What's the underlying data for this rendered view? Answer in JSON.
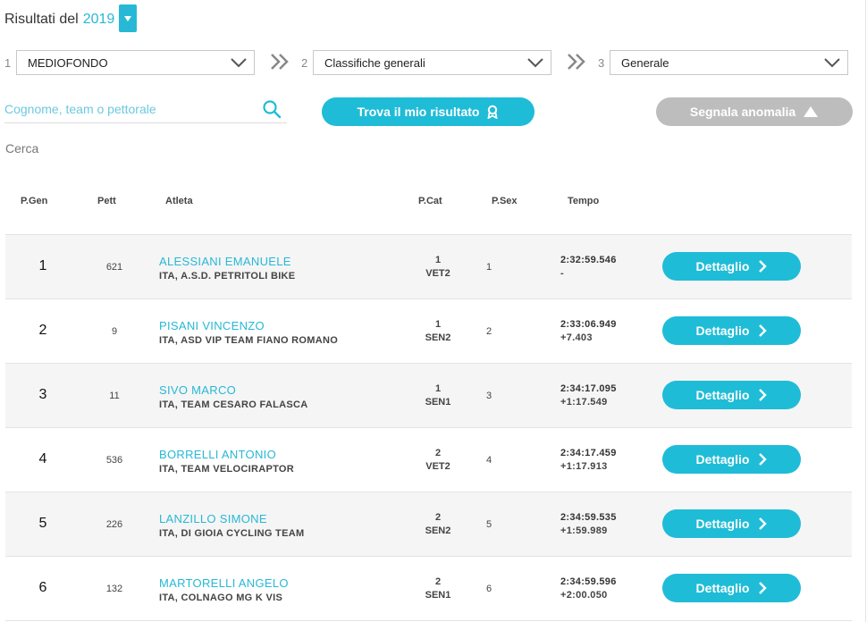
{
  "header": {
    "prefix": "Risultati del",
    "year": "2019"
  },
  "filters": [
    {
      "num": "1",
      "value": "MEDIOFONDO"
    },
    {
      "num": "2",
      "value": "Classifiche generali"
    },
    {
      "num": "3",
      "value": "Generale"
    }
  ],
  "search": {
    "placeholder": "Cognome, team o pettorale",
    "cerca_label": "Cerca"
  },
  "buttons": {
    "find": "Trova il mio risultato",
    "report": "Segnala anomalia",
    "detail": "Dettaglio"
  },
  "columns": {
    "pgen": "P.Gen",
    "pett": "Pett",
    "atleta": "Atleta",
    "pcat": "P.Cat",
    "psex": "P.Sex",
    "tempo": "Tempo"
  },
  "rows": [
    {
      "pos": "1",
      "pett": "621",
      "name": "ALESSIANI EMANUELE",
      "team": "ITA, A.S.D. PETRITOLI BIKE",
      "cat_pos": "1",
      "cat": "VET2",
      "sex": "1",
      "time": "2:32:59.546",
      "gap": "-"
    },
    {
      "pos": "2",
      "pett": "9",
      "name": "PISANI VINCENZO",
      "team": "ITA, ASD VIP TEAM FIANO ROMANO",
      "cat_pos": "1",
      "cat": "SEN2",
      "sex": "2",
      "time": "2:33:06.949",
      "gap": "+7.403"
    },
    {
      "pos": "3",
      "pett": "11",
      "name": "SIVO MARCO",
      "team": "ITA, TEAM CESARO FALASCA",
      "cat_pos": "1",
      "cat": "SEN1",
      "sex": "3",
      "time": "2:34:17.095",
      "gap": "+1:17.549"
    },
    {
      "pos": "4",
      "pett": "536",
      "name": "BORRELLI ANTONIO",
      "team": "ITA, TEAM VELOCIRAPTOR",
      "cat_pos": "2",
      "cat": "VET2",
      "sex": "4",
      "time": "2:34:17.459",
      "gap": "+1:17.913"
    },
    {
      "pos": "5",
      "pett": "226",
      "name": "LANZILLO SIMONE",
      "team": "ITA, DI GIOIA CYCLING TEAM",
      "cat_pos": "2",
      "cat": "SEN2",
      "sex": "5",
      "time": "2:34:59.535",
      "gap": "+1:59.989"
    },
    {
      "pos": "6",
      "pett": "132",
      "name": "MARTORELLI ANGELO",
      "team": "ITA, COLNAGO MG K VIS",
      "cat_pos": "2",
      "cat": "SEN1",
      "sex": "6",
      "time": "2:34:59.596",
      "gap": "+2:00.050"
    }
  ],
  "colors": {
    "accent": "#1fbcd7",
    "disabled": "#bdbdbd",
    "link": "#27b8d6"
  },
  "icons": {
    "search": "search-icon",
    "find": "award-ribbon-icon",
    "report": "warning-triangle-icon",
    "detail": "chevron-right-icon"
  }
}
